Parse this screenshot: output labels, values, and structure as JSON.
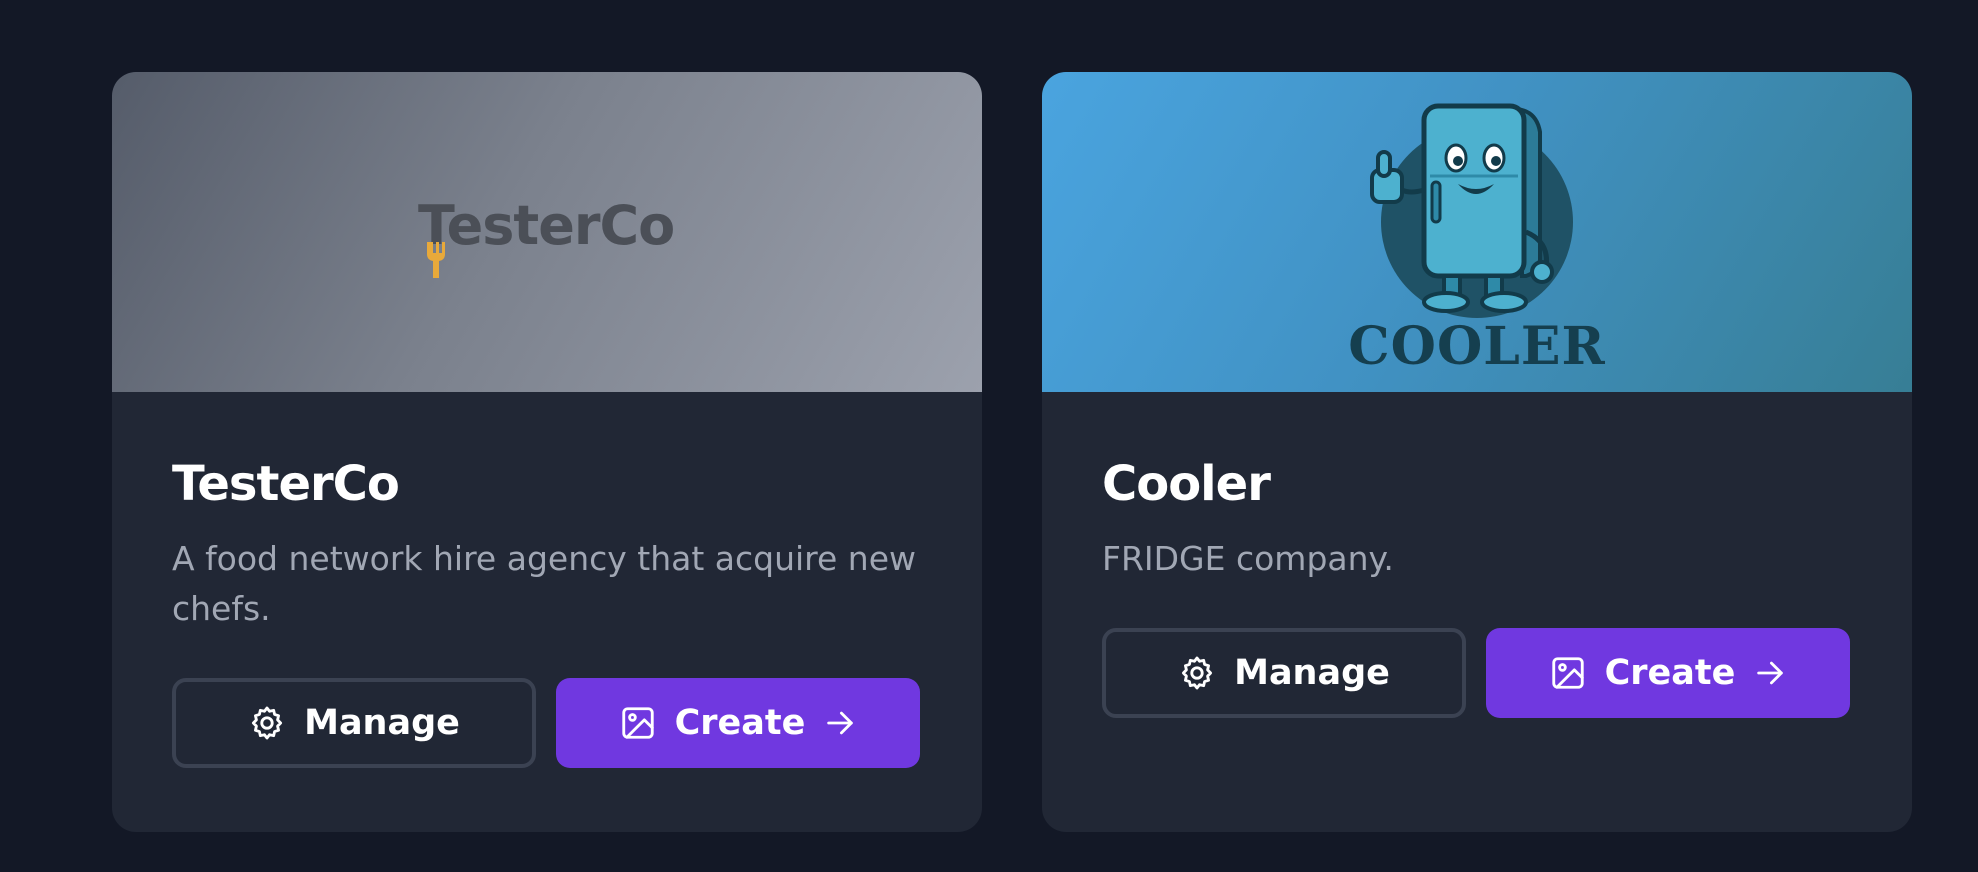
{
  "colors": {
    "background": "#131826",
    "card": "#212735",
    "primary": "#7038e0",
    "outline": "#3b4252",
    "description": "#a1a7b4"
  },
  "projects": [
    {
      "logo_text": "TesterCo",
      "title": "TesterCo",
      "description": "A food network hire agency that acquire new chefs.",
      "manage_label": "Manage",
      "create_label": "Create"
    },
    {
      "logo_text": "COOLER",
      "title": "Cooler",
      "description": "FRIDGE company.",
      "manage_label": "Manage",
      "create_label": "Create"
    }
  ],
  "icons": {
    "manage": "gear-icon",
    "create": "image-icon",
    "arrow": "arrow-right-icon",
    "logo_tc": "fork-icon",
    "logo_cooler": "fridge-mascot"
  }
}
